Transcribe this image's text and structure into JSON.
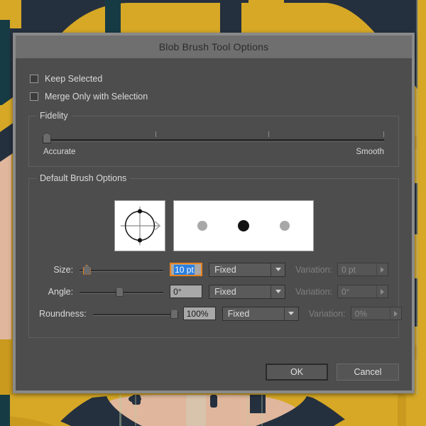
{
  "dialog": {
    "title": "Blob Brush Tool Options",
    "checkboxes": [
      {
        "label": "Keep Selected",
        "checked": false,
        "icon": "checkbox-icon"
      },
      {
        "label": "Merge Only with Selection",
        "checked": false,
        "icon": "checkbox-icon"
      }
    ],
    "fidelity": {
      "title": "Fidelity",
      "left_label": "Accurate",
      "right_label": "Smooth",
      "value_percent": 1,
      "ticks_percent": [
        33,
        66,
        100
      ]
    },
    "brush_options": {
      "title": "Default Brush Options",
      "shape_preview": {
        "icon": "brush-shape-editor-icon",
        "circle_color": "#1a1a1a",
        "crosshair_color": "#8a8a8a",
        "arrow_color": "#9a9a9a"
      },
      "stroke_preview": {
        "icon": "brush-stroke-preview-icon",
        "dots": [
          {
            "fill": "#a8a8a8",
            "radius": 7
          },
          {
            "fill": "#121212",
            "radius": 8
          },
          {
            "fill": "#a8a8a8",
            "radius": 7
          }
        ]
      },
      "rows": [
        {
          "label": "Size:",
          "slider_percent": 8,
          "slider_focused": true,
          "value": "10 pt",
          "value_focused": true,
          "mode": "Fixed",
          "variation_label": "Variation:",
          "variation_value": "0 pt",
          "variation_enabled": false
        },
        {
          "label": "Angle:",
          "slider_percent": 47,
          "slider_focused": false,
          "value": "0°",
          "value_focused": false,
          "mode": "Fixed",
          "variation_label": "Variation:",
          "variation_value": "0°",
          "variation_enabled": false
        },
        {
          "label": "Roundness:",
          "slider_percent": 97,
          "slider_focused": false,
          "value": "100%",
          "value_focused": false,
          "mode": "Fixed",
          "variation_label": "Variation:",
          "variation_value": "0%",
          "variation_enabled": false
        }
      ]
    },
    "footer": {
      "ok_label": "OK",
      "cancel_label": "Cancel"
    }
  },
  "colors": {
    "accent_focus": "#e8821e",
    "selection_blue": "#2a7fe0",
    "titlebar": "#6f6f6f",
    "dialog_bg": "#4d4d4d",
    "artwork_gold": "#d6a826",
    "artwork_gold_dark": "#c99a1e",
    "artwork_navy": "#25303f",
    "artwork_teal": "#173b44",
    "artwork_skin": "#e0b79c"
  }
}
